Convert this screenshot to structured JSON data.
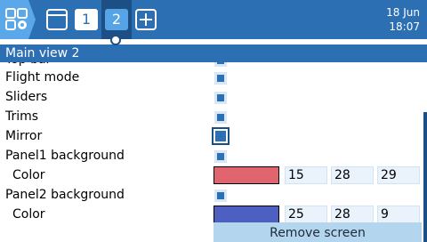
{
  "topbar": {
    "menu_icon": "grid-menu-icon",
    "screen_icon": "window-icon",
    "tabs": [
      "1",
      "2"
    ],
    "active_tab": "2",
    "add_tab_icon": "plus-icon",
    "date": "18 Jun",
    "time": "18:07"
  },
  "title": "Main view 2",
  "rows": {
    "partial_label": "Top bar",
    "flight_mode": "Flight mode",
    "sliders": "Sliders",
    "trims": "Trims",
    "mirror": "Mirror",
    "panel1_bg": "Panel1 background",
    "color1": {
      "label": "Color",
      "hex": "#e0656f",
      "values": [
        "15",
        "28",
        "29"
      ]
    },
    "panel2_bg": "Panel2 background",
    "color2": {
      "label": "Color",
      "hex": "#4e5fc2",
      "values": [
        "25",
        "28",
        "9"
      ]
    }
  },
  "remove_screen": "Remove screen",
  "colors": {
    "accent": "#2d6fb3",
    "accent_dark": "#1c4f86",
    "button": "#b3d6ee"
  }
}
